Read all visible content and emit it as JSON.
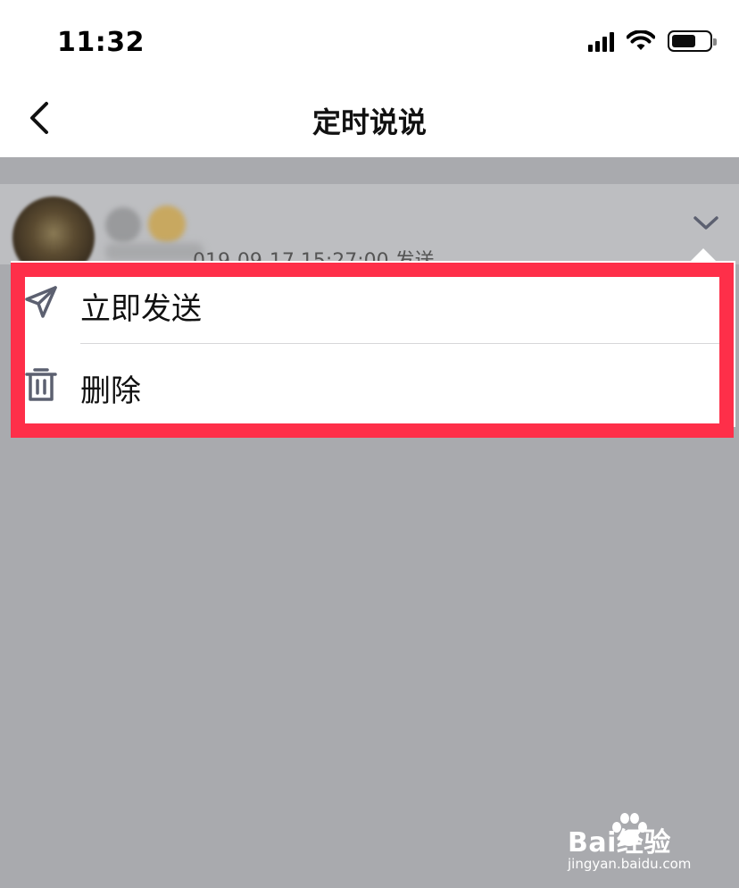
{
  "status_bar": {
    "time": "11:32"
  },
  "nav": {
    "title": "定时说说",
    "back_icon": "chevron-left-icon"
  },
  "post": {
    "time_text": "019-09-17 15:27:00 发送",
    "expand_icon": "chevron-down-icon"
  },
  "menu": {
    "items": [
      {
        "label": "立即发送",
        "icon": "send-icon"
      },
      {
        "label": "删除",
        "icon": "trash-icon"
      }
    ]
  },
  "watermark": {
    "brand": "Bai经验",
    "site": "jingyan.baidu.com"
  },
  "colors": {
    "overlay": "#a9aaae",
    "highlight": "#fe2f49",
    "icon": "#5c6070"
  }
}
